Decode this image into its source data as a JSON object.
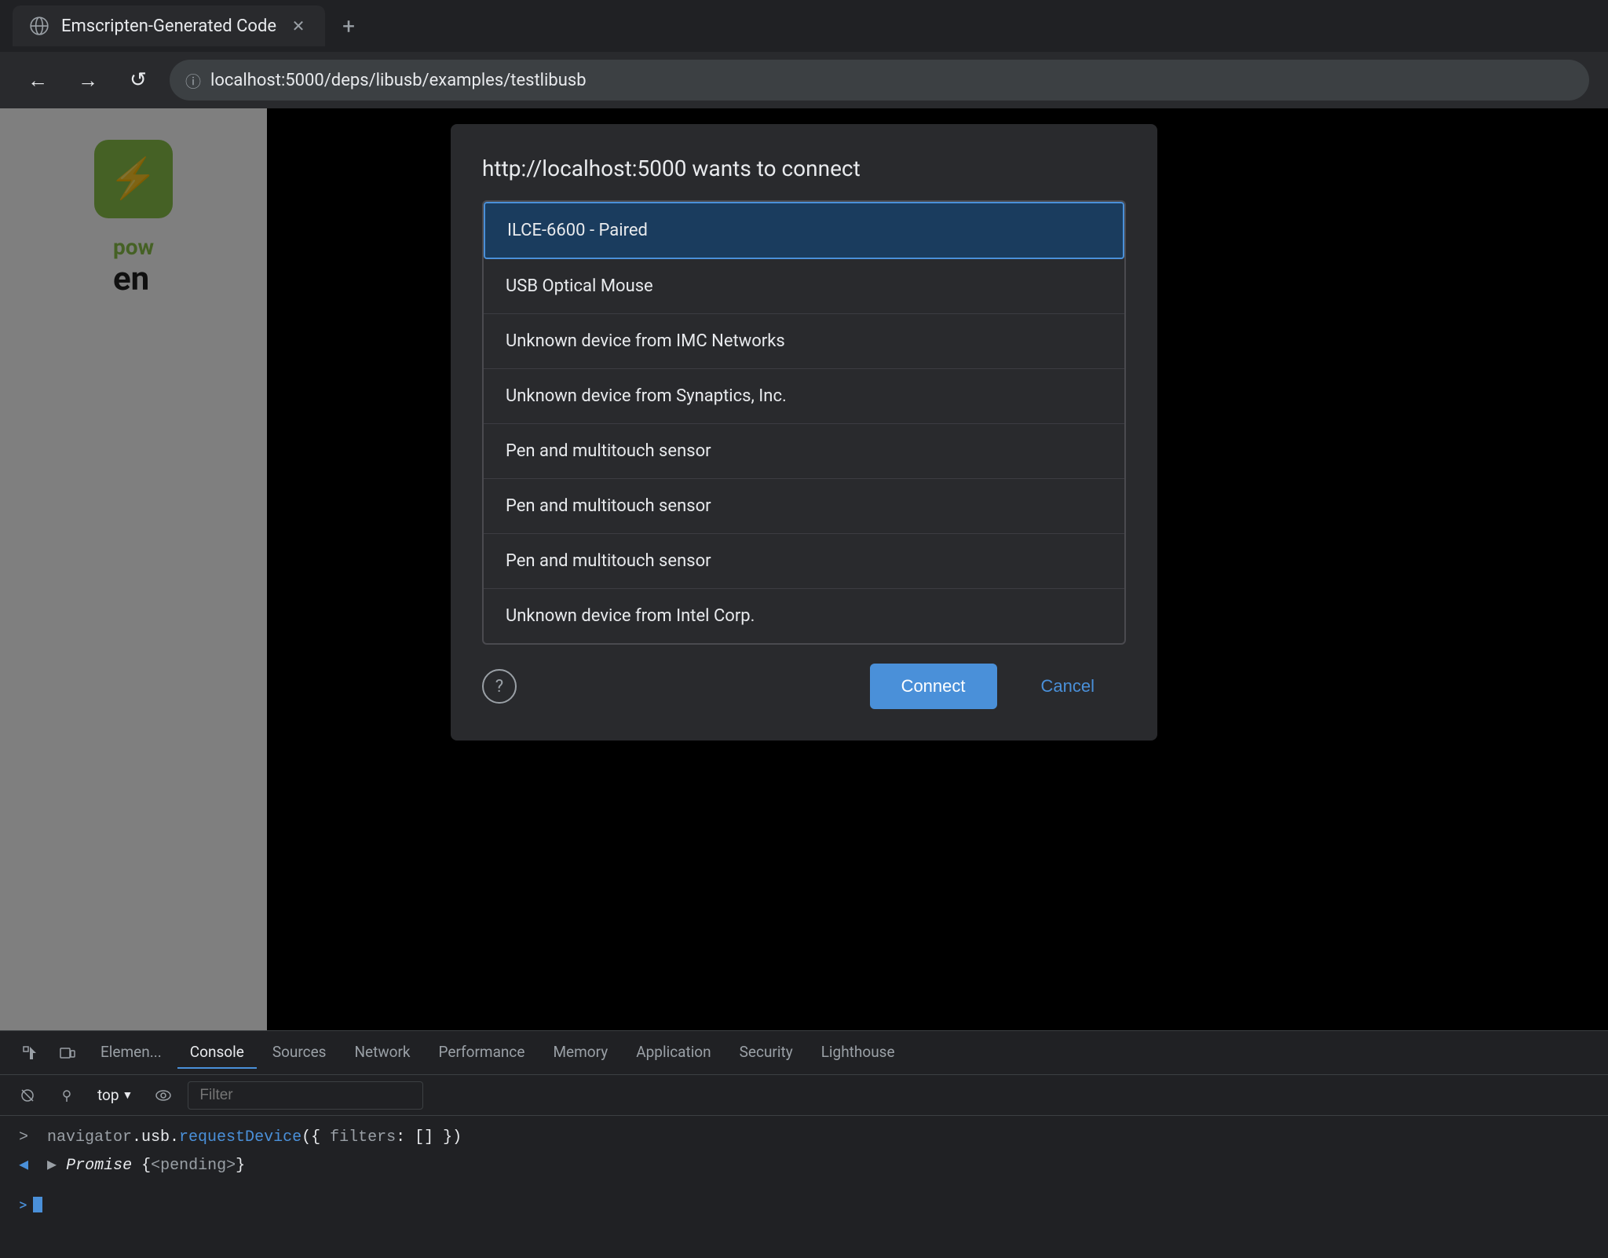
{
  "browser": {
    "tab": {
      "title": "Emscripten-Generated Code",
      "favicon_symbol": "🌐"
    },
    "new_tab_label": "+",
    "address": "localhost:5000/deps/libusb/examples/testlibusb",
    "nav": {
      "back": "←",
      "forward": "→",
      "reload": "↺"
    }
  },
  "dialog": {
    "title": "http://localhost:5000 wants to connect",
    "devices": [
      {
        "id": "ilce6600",
        "label": "ILCE-6600 - Paired",
        "selected": true
      },
      {
        "id": "usb-mouse",
        "label": "USB Optical Mouse",
        "selected": false
      },
      {
        "id": "imc-networks",
        "label": "Unknown device from IMC Networks",
        "selected": false
      },
      {
        "id": "synaptics",
        "label": "Unknown device from Synaptics, Inc.",
        "selected": false
      },
      {
        "id": "pen-multi-1",
        "label": "Pen and multitouch sensor",
        "selected": false
      },
      {
        "id": "pen-multi-2",
        "label": "Pen and multitouch sensor",
        "selected": false
      },
      {
        "id": "pen-multi-3",
        "label": "Pen and multitouch sensor",
        "selected": false
      },
      {
        "id": "intel-corp",
        "label": "Unknown device from Intel Corp.",
        "selected": false
      }
    ],
    "buttons": {
      "connect": "Connect",
      "cancel": "Cancel"
    },
    "help_label": "?"
  },
  "app": {
    "name_pow": "pow",
    "name_en": "en"
  },
  "devtools": {
    "tabs": [
      {
        "id": "elements",
        "label": "Elemen..."
      },
      {
        "id": "console",
        "label": "Console",
        "active": true
      },
      {
        "id": "sources",
        "label": "Sources"
      },
      {
        "id": "network",
        "label": "Network"
      },
      {
        "id": "performance",
        "label": "Performance"
      },
      {
        "id": "memory",
        "label": "Memory"
      },
      {
        "id": "application",
        "label": "Application"
      },
      {
        "id": "security",
        "label": "Security"
      },
      {
        "id": "lighthouse",
        "label": "Lighthouse"
      }
    ],
    "toolbar": {
      "top_label": "top",
      "filter_placeholder": "Filter"
    },
    "console_lines": [
      {
        "prompt": ">",
        "type": "input",
        "code": "navigator.usb.requestDevice({ filters: [] })"
      },
      {
        "prompt": "◄",
        "type": "output",
        "code": "▶ Promise {<pending>}"
      }
    ],
    "bottom_prompt": ">"
  }
}
